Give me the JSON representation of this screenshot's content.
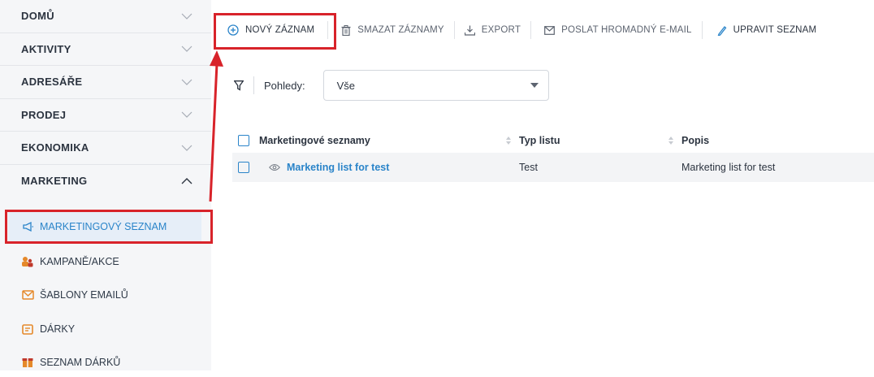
{
  "sidebar": {
    "sections": [
      {
        "label": "DOMŮ",
        "expanded": false
      },
      {
        "label": "AKTIVITY",
        "expanded": false
      },
      {
        "label": "ADRESÁŘE",
        "expanded": false
      },
      {
        "label": "PRODEJ",
        "expanded": false
      },
      {
        "label": "EKONOMIKA",
        "expanded": false
      },
      {
        "label": "MARKETING",
        "expanded": true
      }
    ],
    "marketing_items": [
      {
        "label": "MARKETINGOVÝ SEZNAM",
        "icon": "megaphone-icon",
        "active": true
      },
      {
        "label": "KAMPANĚ/AKCE",
        "icon": "campaign-icon",
        "active": false
      },
      {
        "label": "ŠABLONY EMAILŮ",
        "icon": "envelope-icon",
        "active": false
      },
      {
        "label": "DÁRKY",
        "icon": "gift-card-icon",
        "active": false
      },
      {
        "label": "SEZNAM DÁRKŮ",
        "icon": "gift-list-icon",
        "active": false
      }
    ]
  },
  "toolbar": {
    "new_record": "NOVÝ ZÁZNAM",
    "delete_records": "SMAZAT ZÁZNAMY",
    "export": "EXPORT",
    "bulk_email": "POSLAT HROMADNÝ E-MAIL",
    "edit_list": "UPRAVIT SEZNAM"
  },
  "filter": {
    "views_label": "Pohledy:",
    "selected_view": "Vše"
  },
  "table": {
    "columns": [
      "Marketingové seznamy",
      "Typ listu",
      "Popis"
    ],
    "rows": [
      {
        "name": "Marketing list for test",
        "type": "Test",
        "description": "Marketing list for test"
      }
    ]
  },
  "colors": {
    "accent": "#2a84c9",
    "highlight": "#d8232a",
    "active_bg": "#e6eef8"
  }
}
